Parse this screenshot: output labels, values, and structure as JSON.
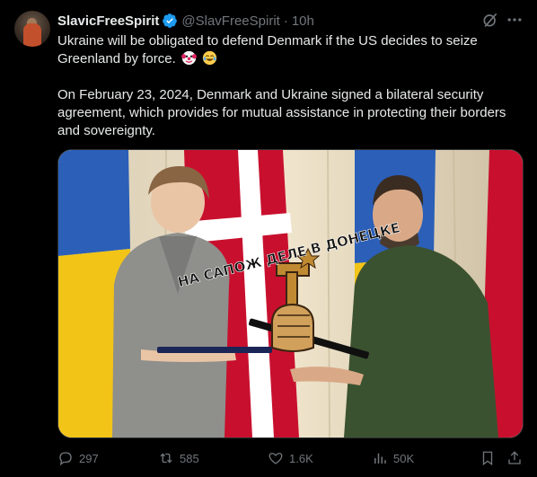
{
  "tweet": {
    "author": {
      "name": "SlavicFreeSpirit",
      "handle": "@SlavFreeSpirit",
      "separator": "·",
      "time": "10h"
    },
    "text": {
      "line1": "Ukraine will be obligated to defend Denmark if the US decides to seize Greenland by force.",
      "line2": "On February 23, 2024, Denmark and Ukraine signed a bilateral security agreement, which provides for mutual assistance in protecting their borders and sovereignty."
    },
    "emojis": [
      "clown-face",
      "face-with-tears-of-joy"
    ],
    "media": {
      "overlay_caption": "НА САПОЖ ДЕЛЕ В ДОНЕЦКЕ"
    },
    "actions": {
      "replies": "297",
      "reposts": "585",
      "likes": "1.6K",
      "views": "50K"
    }
  },
  "colors": {
    "background": "#000000",
    "text": "#e7e9ea",
    "muted": "#71767b",
    "verified": "#1d9bf0",
    "divider": "#2f3336"
  }
}
